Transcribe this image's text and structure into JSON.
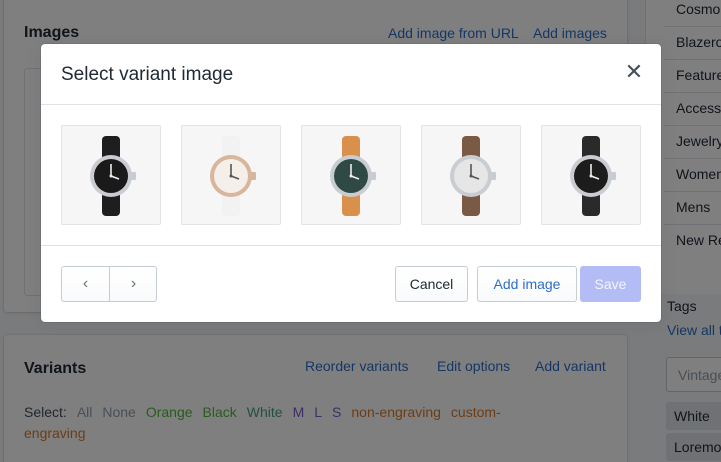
{
  "images_card": {
    "title": "Images",
    "add_from_url": "Add image from URL",
    "add_images": "Add images"
  },
  "variants_card": {
    "title": "Variants",
    "reorder": "Reorder variants",
    "edit_options": "Edit options",
    "add_variant": "Add variant",
    "select_label": "Select:",
    "filters": [
      "All",
      "None",
      "Orange",
      "Black",
      "White",
      "M",
      "L",
      "S",
      "non-engraving",
      "custom-engraving"
    ]
  },
  "collections": [
    "Cosmo",
    "Blazero",
    "Feature",
    "Access",
    "Jewelry",
    "Women",
    "Mens",
    "New Re"
  ],
  "tags": {
    "label": "Tags",
    "view_all": "View all t",
    "input_placeholder": "Vintage",
    "chips": [
      "White",
      "Loremo"
    ]
  },
  "modal": {
    "title": "Select variant image",
    "close": "✕",
    "images": [
      {
        "name": "watch-black-dial-black-strap",
        "strap": "#1e1e1e",
        "dial": "#1a1a1a",
        "case": "#c9cdd2"
      },
      {
        "name": "watch-white-rose-gold",
        "strap": "#f2f2f2",
        "dial": "#f4efe9",
        "case": "#d8b59d"
      },
      {
        "name": "watch-green-dial-tan-strap",
        "strap": "#d9904b",
        "dial": "#2f4a44",
        "case": "#c9cdd2"
      },
      {
        "name": "watch-silver-dial-brown-strap",
        "strap": "#7a5a45",
        "dial": "#e6e6e6",
        "case": "#c9cdd2"
      },
      {
        "name": "watch-black-dial-red-accent",
        "strap": "#2a2a2a",
        "dial": "#1c1c1c",
        "case": "#c9cdd2"
      }
    ],
    "prev": "‹",
    "next": "›",
    "cancel": "Cancel",
    "add_image": "Add image",
    "save": "Save"
  },
  "colors": {
    "link": "#2c6ecb",
    "save_disabled": "#b3bcf5"
  }
}
